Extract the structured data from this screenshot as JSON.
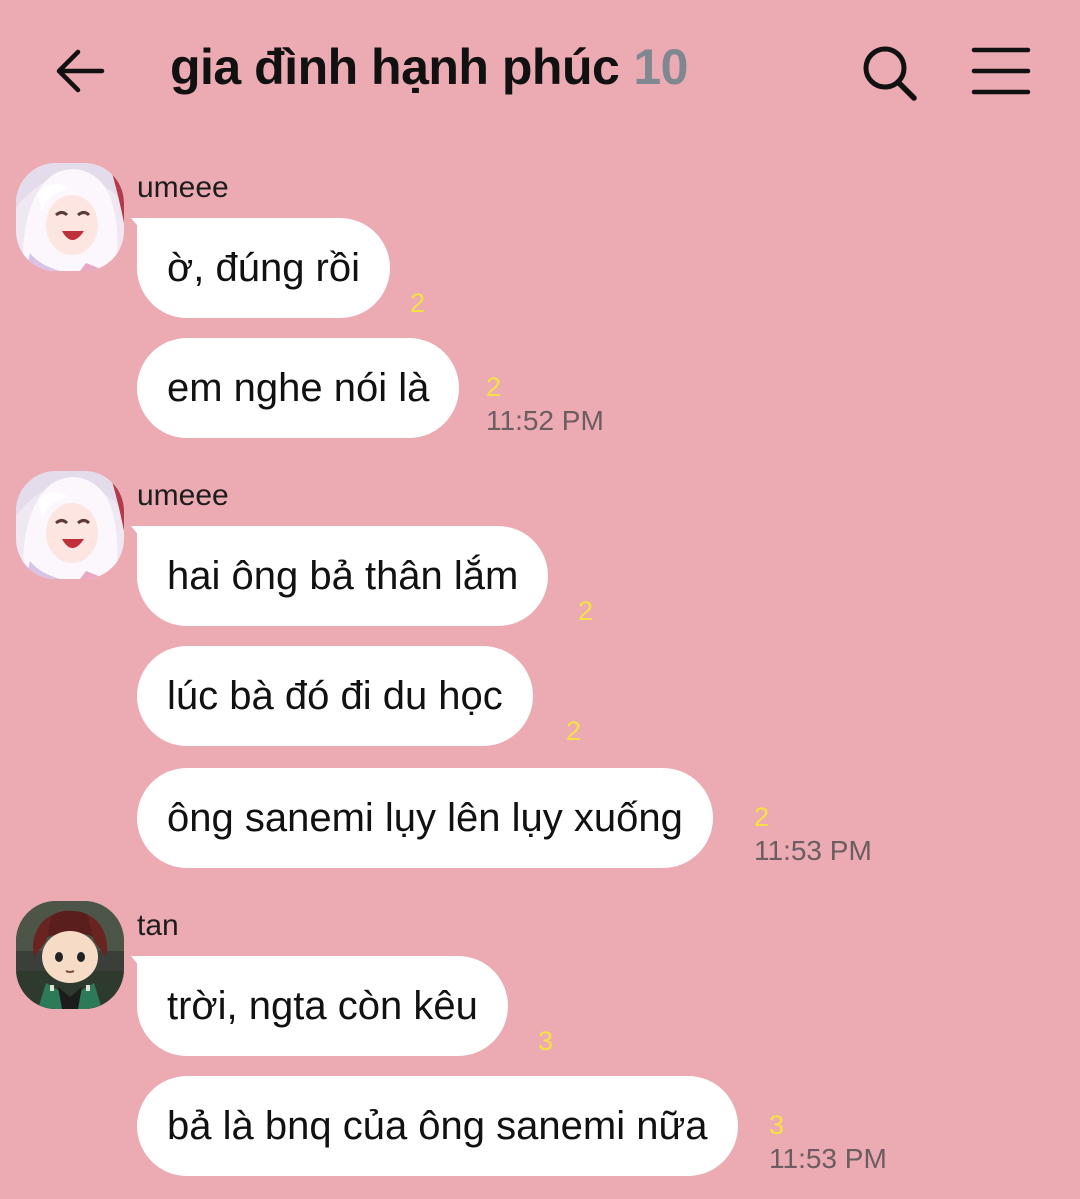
{
  "header": {
    "title": "gia đình hạnh phúc",
    "member_count": "10"
  },
  "messages": [
    {
      "sender": "umeee",
      "text": "ờ, đúng rồi",
      "unread": "2",
      "time": ""
    },
    {
      "sender": "",
      "text": "em nghe nói là",
      "unread": "2",
      "time": "11:52 PM"
    },
    {
      "sender": "umeee",
      "text": "hai ông bả thân lắm",
      "unread": "2",
      "time": ""
    },
    {
      "sender": "",
      "text": "lúc bà đó đi du học",
      "unread": "2",
      "time": ""
    },
    {
      "sender": "",
      "text": "ông sanemi lụy lên lụy xuống",
      "unread": "2",
      "time": "11:53 PM"
    },
    {
      "sender": "tan",
      "text": "trời, ngta còn kêu",
      "unread": "3",
      "time": ""
    },
    {
      "sender": "",
      "text": "bả là bnq của ông sanemi nữa",
      "unread": "3",
      "time": "11:53 PM"
    }
  ],
  "colors": {
    "background": "#ecaab2",
    "bubble": "#ffffff",
    "unread": "#f4e243",
    "member_count": "#7f8890"
  },
  "icons": {
    "back": "back-arrow-icon",
    "search": "search-icon",
    "menu": "hamburger-menu-icon"
  }
}
